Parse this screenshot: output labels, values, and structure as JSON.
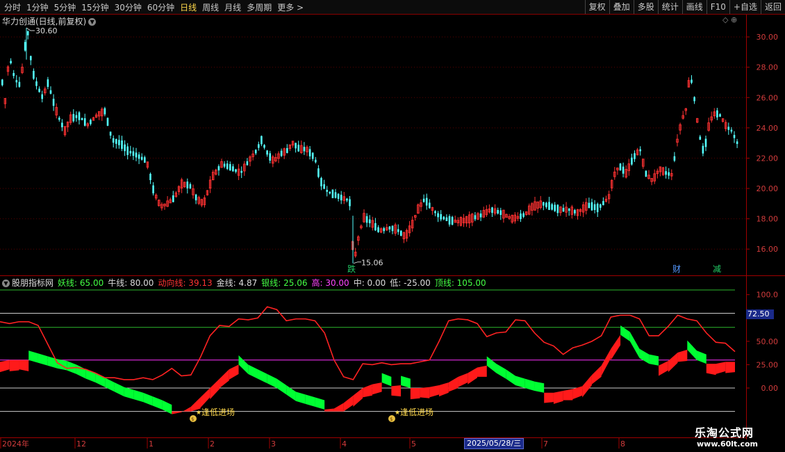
{
  "toolbar": {
    "tabs": [
      "分时",
      "1分钟",
      "5分钟",
      "15分钟",
      "30分钟",
      "60分钟",
      "日线",
      "周线",
      "月线",
      "多周期",
      "更多 >"
    ],
    "active_tab": "日线",
    "right_tools": [
      "复权",
      "叠加",
      "多股",
      "统计",
      "画线",
      "F10",
      "+自选",
      "返回"
    ]
  },
  "chart_title": "华力创通(日线,前复权)",
  "top_right_icons": "◇ ⊕",
  "price_panel": {
    "y_ticks": [
      "30.00",
      "28.00",
      "26.00",
      "24.00",
      "22.00",
      "20.00",
      "18.00",
      "16.00"
    ],
    "high_label": "30.60",
    "low_label": "15.06",
    "markers": [
      "跌",
      "财",
      "减"
    ]
  },
  "indicator_bar": {
    "name": "股朋指标网",
    "items": [
      {
        "label": "妖线: 65.00",
        "color": "#44ff44"
      },
      {
        "label": "牛线: 80.00",
        "color": "#dddddd"
      },
      {
        "label": "动向线: 39.13",
        "color": "#ff3333"
      },
      {
        "label": "金线: 4.87",
        "color": "#dddddd"
      },
      {
        "label": "银线: 25.06",
        "color": "#44ff44"
      },
      {
        "label": "高: 30.00",
        "color": "#ff44ff"
      },
      {
        "label": "中: 0.00",
        "color": "#dddddd"
      },
      {
        "label": "低: -25.00",
        "color": "#dddddd"
      },
      {
        "label": "顶线: 105.00",
        "color": "#44ff44"
      }
    ]
  },
  "indicator_panel": {
    "y_ticks": [
      "100.0",
      "75.00",
      "50.00",
      "25.00",
      "0.00"
    ],
    "current_value": "72.50",
    "signals": [
      "逢低进场",
      "逢低进场"
    ]
  },
  "date_axis": {
    "labels": [
      "2024年",
      "12",
      "1",
      "2",
      "3",
      "4",
      "5",
      "7",
      "8"
    ],
    "highlight": "2025/05/28/三"
  },
  "watermark": {
    "title": "乐淘公式网",
    "url": "www.60lt.com"
  },
  "colors": {
    "up": "#ff3232",
    "down": "#54ffff",
    "fill_up": "#ff1a1a",
    "fill_down": "#00ff33",
    "frame": "#a00000"
  },
  "chart_data": {
    "type": "line",
    "series": [
      {
        "values": [
          71,
          69,
          71,
          71,
          67,
          47,
          27,
          21,
          22,
          20,
          16,
          11,
          11,
          9,
          9,
          11,
          9,
          14,
          21,
          13,
          14,
          33,
          56,
          67,
          66,
          74,
          73,
          75,
          87,
          84,
          72,
          74,
          74,
          72,
          59,
          30,
          12,
          9,
          26,
          25,
          27,
          25,
          26,
          26,
          28,
          30,
          50,
          72,
          74,
          73,
          69,
          55,
          59,
          60,
          73,
          72,
          59,
          49,
          45,
          36,
          43,
          46,
          50,
          56,
          76,
          78,
          78,
          74,
          56,
          56,
          66,
          78,
          74,
          72,
          59,
          49,
          48,
          39
        ]
      },
      {
        "values": [
          28,
          30,
          30,
          30,
          27,
          24,
          21,
          19,
          15,
          10,
          6,
          1,
          -4,
          -9,
          -12,
          -15,
          -19,
          -23,
          -28,
          -26,
          -20,
          -10,
          0,
          10,
          20,
          25,
          15,
          10,
          5,
          0,
          -7,
          -14,
          -17,
          -20,
          -23,
          -22,
          -16,
          -8,
          0,
          4,
          6,
          2,
          3,
          0,
          0,
          1,
          3,
          6,
          12,
          16,
          22,
          24,
          16,
          10,
          3,
          0,
          -3,
          -5,
          -5,
          -3,
          -1,
          2,
          14,
          24,
          42,
          57,
          50,
          32,
          26,
          24,
          29,
          38,
          41,
          30,
          26,
          26,
          28,
          28
        ]
      }
    ]
  }
}
